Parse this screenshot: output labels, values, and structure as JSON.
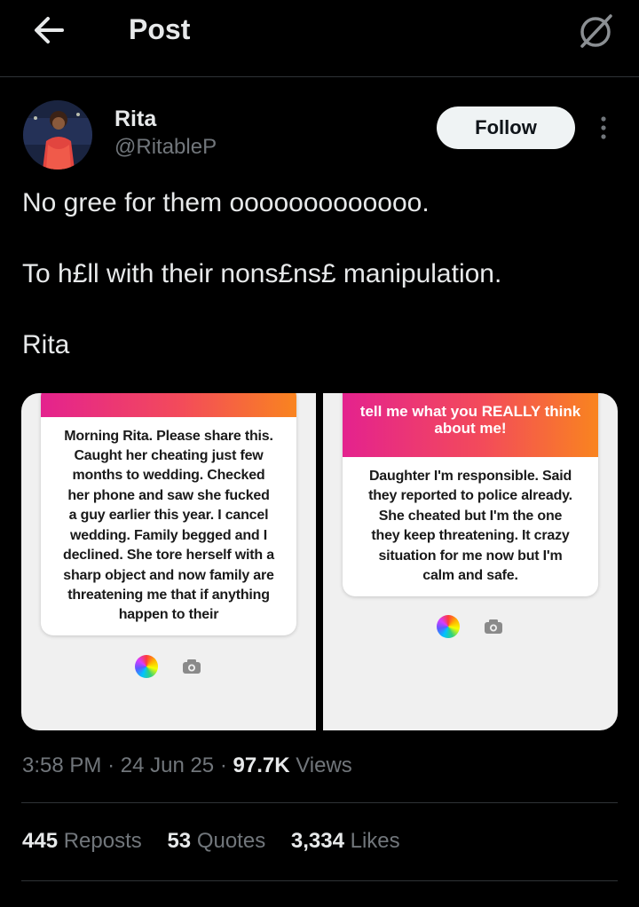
{
  "header": {
    "title": "Post",
    "back_icon": "arrow-left-icon",
    "grok_icon": "grok-icon"
  },
  "author": {
    "name": "Rita",
    "handle": "@RitableP",
    "follow_label": "Follow",
    "more_icon": "more-vertical-icon"
  },
  "tweet": {
    "lines": [
      "No gree for them ooooooooooooo.",
      "To h£ll with their nons£ns£ manipulation.",
      "Rita"
    ]
  },
  "media": {
    "left": {
      "lines": [
        "Morning Rita.  Please share this.",
        "Caught her cheating just few",
        "months to wedding.  Checked",
        "her phone and saw she fucked",
        "a guy earlier this year.  I cancel",
        "wedding.  Family begged and I",
        "declined.  She tore herself with a",
        "sharp object and now family are",
        "threatening me that if anything",
        "happen to their"
      ]
    },
    "right": {
      "prompt_lines": [
        "tell me what you REALLY think",
        "about me!"
      ],
      "lines": [
        "Daughter I'm responsible. Said",
        "they reported to police already.",
        "She cheated but I'm the one",
        "they keep threatening. It crazy",
        "situation for me now but I'm",
        "calm and safe."
      ]
    }
  },
  "meta": {
    "time": "3:58 PM",
    "sep": "·",
    "date": "24 Jun 25",
    "views_count": "97.7K",
    "views_label": "Views"
  },
  "stats": {
    "reposts_count": "445",
    "reposts_label": "Reposts",
    "quotes_count": "53",
    "quotes_label": "Quotes",
    "likes_count": "3,334",
    "likes_label": "Likes"
  },
  "colors": {
    "background": "#000000",
    "text": "#e7e9ea",
    "muted": "#71767b",
    "follow_bg": "#eff3f4",
    "gradient_start": "#e4228e",
    "gradient_end": "#f9841f"
  }
}
